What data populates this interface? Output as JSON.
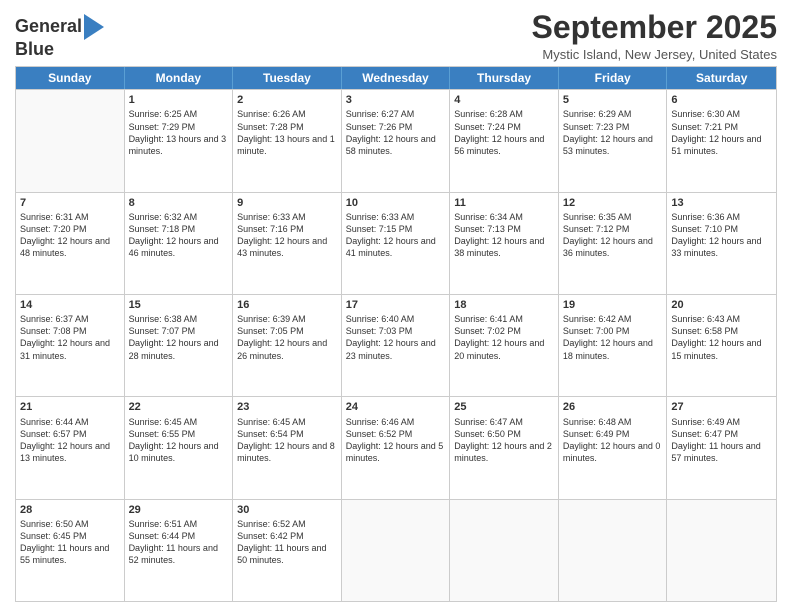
{
  "logo": {
    "line1": "General",
    "line2": "Blue",
    "icon": "▶"
  },
  "header": {
    "month_title": "September 2025",
    "subtitle": "Mystic Island, New Jersey, United States"
  },
  "weekdays": [
    "Sunday",
    "Monday",
    "Tuesday",
    "Wednesday",
    "Thursday",
    "Friday",
    "Saturday"
  ],
  "weeks": [
    [
      {
        "day": "",
        "sunrise": "",
        "sunset": "",
        "daylight": ""
      },
      {
        "day": "1",
        "sunrise": "Sunrise: 6:25 AM",
        "sunset": "Sunset: 7:29 PM",
        "daylight": "Daylight: 13 hours and 3 minutes."
      },
      {
        "day": "2",
        "sunrise": "Sunrise: 6:26 AM",
        "sunset": "Sunset: 7:28 PM",
        "daylight": "Daylight: 13 hours and 1 minute."
      },
      {
        "day": "3",
        "sunrise": "Sunrise: 6:27 AM",
        "sunset": "Sunset: 7:26 PM",
        "daylight": "Daylight: 12 hours and 58 minutes."
      },
      {
        "day": "4",
        "sunrise": "Sunrise: 6:28 AM",
        "sunset": "Sunset: 7:24 PM",
        "daylight": "Daylight: 12 hours and 56 minutes."
      },
      {
        "day": "5",
        "sunrise": "Sunrise: 6:29 AM",
        "sunset": "Sunset: 7:23 PM",
        "daylight": "Daylight: 12 hours and 53 minutes."
      },
      {
        "day": "6",
        "sunrise": "Sunrise: 6:30 AM",
        "sunset": "Sunset: 7:21 PM",
        "daylight": "Daylight: 12 hours and 51 minutes."
      }
    ],
    [
      {
        "day": "7",
        "sunrise": "Sunrise: 6:31 AM",
        "sunset": "Sunset: 7:20 PM",
        "daylight": "Daylight: 12 hours and 48 minutes."
      },
      {
        "day": "8",
        "sunrise": "Sunrise: 6:32 AM",
        "sunset": "Sunset: 7:18 PM",
        "daylight": "Daylight: 12 hours and 46 minutes."
      },
      {
        "day": "9",
        "sunrise": "Sunrise: 6:33 AM",
        "sunset": "Sunset: 7:16 PM",
        "daylight": "Daylight: 12 hours and 43 minutes."
      },
      {
        "day": "10",
        "sunrise": "Sunrise: 6:33 AM",
        "sunset": "Sunset: 7:15 PM",
        "daylight": "Daylight: 12 hours and 41 minutes."
      },
      {
        "day": "11",
        "sunrise": "Sunrise: 6:34 AM",
        "sunset": "Sunset: 7:13 PM",
        "daylight": "Daylight: 12 hours and 38 minutes."
      },
      {
        "day": "12",
        "sunrise": "Sunrise: 6:35 AM",
        "sunset": "Sunset: 7:12 PM",
        "daylight": "Daylight: 12 hours and 36 minutes."
      },
      {
        "day": "13",
        "sunrise": "Sunrise: 6:36 AM",
        "sunset": "Sunset: 7:10 PM",
        "daylight": "Daylight: 12 hours and 33 minutes."
      }
    ],
    [
      {
        "day": "14",
        "sunrise": "Sunrise: 6:37 AM",
        "sunset": "Sunset: 7:08 PM",
        "daylight": "Daylight: 12 hours and 31 minutes."
      },
      {
        "day": "15",
        "sunrise": "Sunrise: 6:38 AM",
        "sunset": "Sunset: 7:07 PM",
        "daylight": "Daylight: 12 hours and 28 minutes."
      },
      {
        "day": "16",
        "sunrise": "Sunrise: 6:39 AM",
        "sunset": "Sunset: 7:05 PM",
        "daylight": "Daylight: 12 hours and 26 minutes."
      },
      {
        "day": "17",
        "sunrise": "Sunrise: 6:40 AM",
        "sunset": "Sunset: 7:03 PM",
        "daylight": "Daylight: 12 hours and 23 minutes."
      },
      {
        "day": "18",
        "sunrise": "Sunrise: 6:41 AM",
        "sunset": "Sunset: 7:02 PM",
        "daylight": "Daylight: 12 hours and 20 minutes."
      },
      {
        "day": "19",
        "sunrise": "Sunrise: 6:42 AM",
        "sunset": "Sunset: 7:00 PM",
        "daylight": "Daylight: 12 hours and 18 minutes."
      },
      {
        "day": "20",
        "sunrise": "Sunrise: 6:43 AM",
        "sunset": "Sunset: 6:58 PM",
        "daylight": "Daylight: 12 hours and 15 minutes."
      }
    ],
    [
      {
        "day": "21",
        "sunrise": "Sunrise: 6:44 AM",
        "sunset": "Sunset: 6:57 PM",
        "daylight": "Daylight: 12 hours and 13 minutes."
      },
      {
        "day": "22",
        "sunrise": "Sunrise: 6:45 AM",
        "sunset": "Sunset: 6:55 PM",
        "daylight": "Daylight: 12 hours and 10 minutes."
      },
      {
        "day": "23",
        "sunrise": "Sunrise: 6:45 AM",
        "sunset": "Sunset: 6:54 PM",
        "daylight": "Daylight: 12 hours and 8 minutes."
      },
      {
        "day": "24",
        "sunrise": "Sunrise: 6:46 AM",
        "sunset": "Sunset: 6:52 PM",
        "daylight": "Daylight: 12 hours and 5 minutes."
      },
      {
        "day": "25",
        "sunrise": "Sunrise: 6:47 AM",
        "sunset": "Sunset: 6:50 PM",
        "daylight": "Daylight: 12 hours and 2 minutes."
      },
      {
        "day": "26",
        "sunrise": "Sunrise: 6:48 AM",
        "sunset": "Sunset: 6:49 PM",
        "daylight": "Daylight: 12 hours and 0 minutes."
      },
      {
        "day": "27",
        "sunrise": "Sunrise: 6:49 AM",
        "sunset": "Sunset: 6:47 PM",
        "daylight": "Daylight: 11 hours and 57 minutes."
      }
    ],
    [
      {
        "day": "28",
        "sunrise": "Sunrise: 6:50 AM",
        "sunset": "Sunset: 6:45 PM",
        "daylight": "Daylight: 11 hours and 55 minutes."
      },
      {
        "day": "29",
        "sunrise": "Sunrise: 6:51 AM",
        "sunset": "Sunset: 6:44 PM",
        "daylight": "Daylight: 11 hours and 52 minutes."
      },
      {
        "day": "30",
        "sunrise": "Sunrise: 6:52 AM",
        "sunset": "Sunset: 6:42 PM",
        "daylight": "Daylight: 11 hours and 50 minutes."
      },
      {
        "day": "",
        "sunrise": "",
        "sunset": "",
        "daylight": ""
      },
      {
        "day": "",
        "sunrise": "",
        "sunset": "",
        "daylight": ""
      },
      {
        "day": "",
        "sunrise": "",
        "sunset": "",
        "daylight": ""
      },
      {
        "day": "",
        "sunrise": "",
        "sunset": "",
        "daylight": ""
      }
    ]
  ]
}
